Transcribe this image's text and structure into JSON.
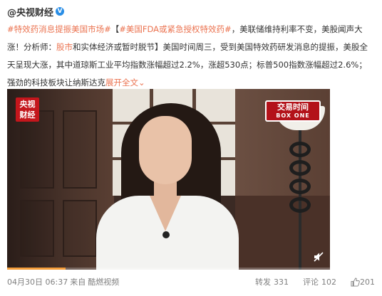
{
  "author": {
    "name": "@央视财经",
    "verified_icon": "verified-badge-icon"
  },
  "post": {
    "segments": [
      {
        "type": "link",
        "text": "#特效药消息提振美国市场#"
      },
      {
        "type": "text",
        "text": "【"
      },
      {
        "type": "link",
        "text": "#美国FDA或紧急授权特效药#"
      },
      {
        "type": "text",
        "text": "，美联储维持利率不变，美股闻声大涨！分析师："
      },
      {
        "type": "link",
        "text": "股市"
      },
      {
        "type": "text",
        "text": "和实体经济或暂时脱节】美国时间周三，受到美国特效药研发消息的提振，美股全天呈现大涨，其中道琼斯工业平均指数涨幅超过2.2%，涨超530点；标普500指数涨幅超过2.6%；强劲的科技板块让纳斯达克"
      },
      {
        "type": "link",
        "text": "展开全文"
      },
      {
        "type": "link",
        "text": "⌄"
      }
    ]
  },
  "video": {
    "cctv_logo": "央视\n财经",
    "show_logo_main": "交易时间",
    "show_logo_sub": "BOX ONE",
    "progress": 0.18,
    "progress_color": "#f59e3b",
    "mute_icon": "mute-icon"
  },
  "footer": {
    "date": "04月30日 06:37",
    "source_prefix": "来自",
    "source": "酷燃视频",
    "repost_label": "转发",
    "repost_count": "331",
    "comment_label": "评论",
    "comment_count": "102",
    "like_count": "201"
  },
  "colors": {
    "link": "#eb7350",
    "text": "#333333",
    "muted": "#808080",
    "verified": "#2a8ee6"
  }
}
